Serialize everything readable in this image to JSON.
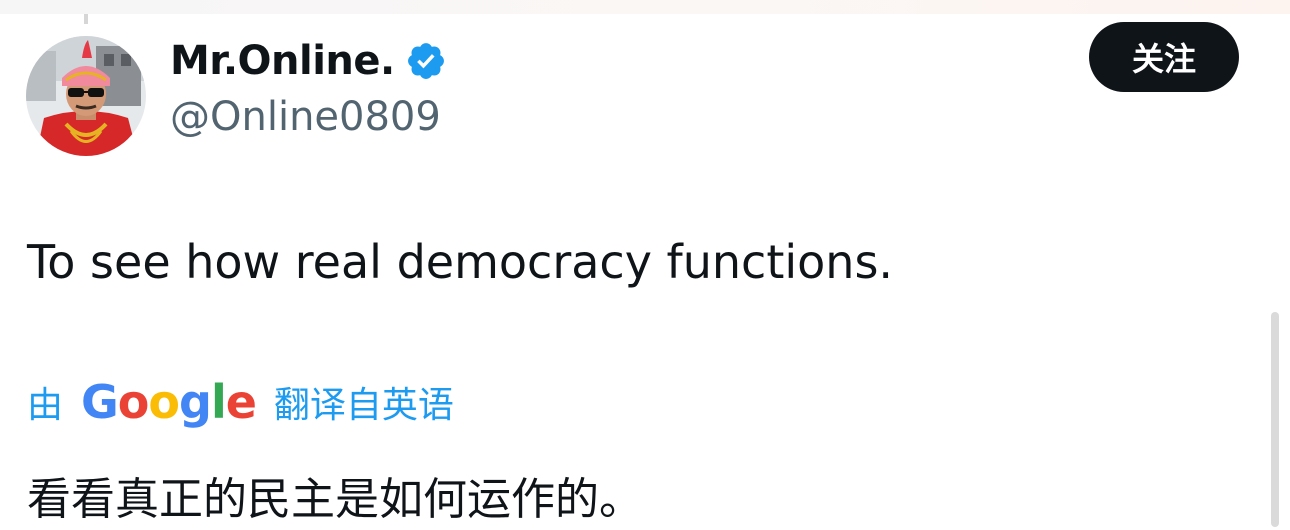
{
  "tweet": {
    "author": {
      "display_name": "Mr.Online.",
      "handle": "@Online0809",
      "verified": true
    },
    "follow_label": "关注",
    "text": "To see how real democracy functions.",
    "translation": {
      "prefix": "由",
      "provider": "Google",
      "suffix": "翻译自英语",
      "text": "看看真正的民主是如何运作的。"
    }
  },
  "colors": {
    "accent": "#1d9bf0",
    "text": "#0f1419",
    "secondary": "#536471",
    "button_bg": "#0f1419"
  },
  "icons": {
    "verified": "verified-badge-icon"
  }
}
